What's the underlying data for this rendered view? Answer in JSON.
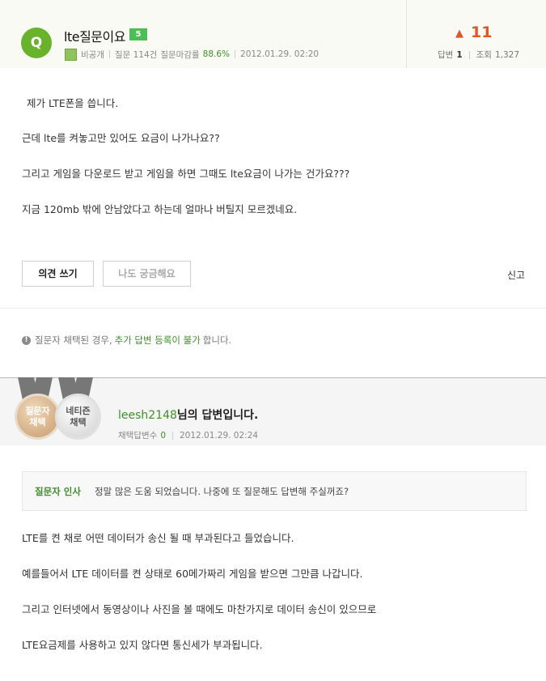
{
  "question": {
    "avatar_letter": "Q",
    "title": "lte질문이요",
    "level": "5",
    "author": "비공개",
    "question_count": "질문 114건",
    "acceptance_label": "질문마감률",
    "acceptance_rate": "88.6%",
    "datetime": "2012.01.29. 02:20",
    "upvote_icon": "thumbs-up-icon",
    "upvotes": "11",
    "answers_label": "답변",
    "answers_count": "1",
    "views_label": "조회",
    "views_count": "1,327",
    "body": [
      "제가 LTE폰을 씁니다.",
      "근데 lte를 켜놓고만 있어도 요금이 나가나요??",
      "그리고 게임을 다운로드 받고 게임을 하면 그때도 lte요금이 나가는 건가요???",
      "지금 120mb 밖에 안남았다고 하는데 얼마나 버틸지 모르겠네요."
    ],
    "opinion_button": "의견 쓰기",
    "curious_button": "나도 궁금해요",
    "report_link": "신고"
  },
  "notice": {
    "prefix": "질문자 채택된 경우,",
    "highlight": "추가 답변 등록이 불가",
    "suffix": "합니다."
  },
  "answer": {
    "medal_gold": {
      "line1": "질문자",
      "line2": "채택"
    },
    "medal_silver": {
      "line1": "네티즌",
      "line2": "채택"
    },
    "username": "leesh2148",
    "title_suffix": "님의 답변입니다.",
    "accepted_label": "채택답변수",
    "accepted_count": "0",
    "datetime": "2012.01.29. 02:24",
    "greeting_label": "질문자 인사",
    "greeting_text": "정말 많은 도움 되었습니다. 나중에 또 질문해도 답변해 주실꺼죠?",
    "body": [
      "LTE를 켠 채로 어떤 데이터가 송신 될 때 부과된다고 들었습니다.",
      "예를들어서 LTE 데이터를 켠 상태로 60메가짜리 게임을 받으면 그만큼 나갑니다.",
      "그리고 인터넷에서 동영상이나 사진을 볼 때에도 마찬가지로 데이터 송신이 있으므로",
      "LTE요금제를 사용하고 있지 않다면 통신세가 부과됩니다."
    ]
  },
  "colors": {
    "accent_green": "#3f8f2a",
    "avatar_green": "#69b22b",
    "upvote_orange": "#e2552b"
  }
}
